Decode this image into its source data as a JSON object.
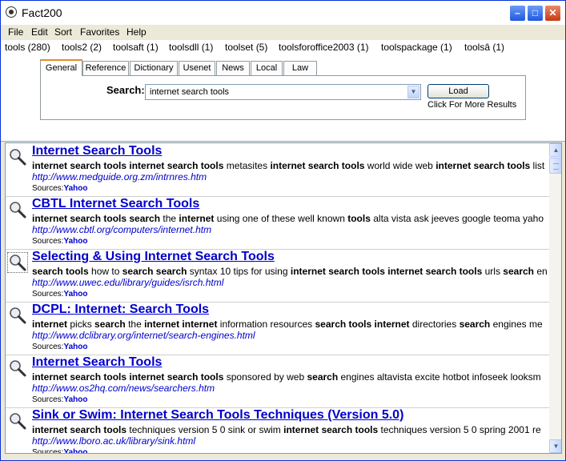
{
  "window": {
    "title": "Fact200"
  },
  "menu": [
    "File",
    "Edit",
    "Sort",
    "Favorites",
    "Help"
  ],
  "query_tabs": [
    "tools (280)",
    "tools2 (2)",
    "toolsaft (1)",
    "toolsdll (1)",
    "toolset (5)",
    "toolsforoffice2003 (1)",
    "toolspackage (1)",
    "toolsâ (1)"
  ],
  "source_tabs": [
    "General",
    "Reference",
    "Dictionary",
    "Usenet",
    "News",
    "Local",
    "Law"
  ],
  "search": {
    "label": "Search:",
    "value": "internet search tools"
  },
  "load": {
    "label": "Load",
    "hint": "Click For More Results"
  },
  "sources_label": "Sources:",
  "results": [
    {
      "title": "Internet Search Tools",
      "snippet": [
        {
          "t": "internet search tools internet search tools",
          "b": true
        },
        {
          "t": " metasites ",
          "b": false
        },
        {
          "t": "internet search tools",
          "b": true
        },
        {
          "t": " world wide web ",
          "b": false
        },
        {
          "t": "internet search tools",
          "b": true
        },
        {
          "t": " list",
          "b": false
        }
      ],
      "url": "http://www.medguide.org.zm/intrnres.htm",
      "source": "Yahoo"
    },
    {
      "title": "CBTL Internet Search Tools",
      "snippet": [
        {
          "t": "internet search tools search",
          "b": true
        },
        {
          "t": " the ",
          "b": false
        },
        {
          "t": "internet",
          "b": true
        },
        {
          "t": " using one of these well known ",
          "b": false
        },
        {
          "t": "tools",
          "b": true
        },
        {
          "t": " alta vista ask jeeves google teoma yaho",
          "b": false
        }
      ],
      "url": "http://www.cbtl.org/computers/internet.htm",
      "source": "Yahoo"
    },
    {
      "title": "Selecting & Using Internet Search Tools",
      "snippet": [
        {
          "t": "search tools",
          "b": true
        },
        {
          "t": " how to ",
          "b": false
        },
        {
          "t": "search search",
          "b": true
        },
        {
          "t": " syntax 10 tips for using ",
          "b": false
        },
        {
          "t": "internet search tools internet search tools",
          "b": true
        },
        {
          "t": " urls ",
          "b": false
        },
        {
          "t": "search",
          "b": true
        },
        {
          "t": " en",
          "b": false
        }
      ],
      "url": "http://www.uwec.edu/library/guides/isrch.html",
      "source": "Yahoo"
    },
    {
      "title": "DCPL: Internet: Search Tools",
      "snippet": [
        {
          "t": "internet",
          "b": true
        },
        {
          "t": " picks ",
          "b": false
        },
        {
          "t": "search",
          "b": true
        },
        {
          "t": " the ",
          "b": false
        },
        {
          "t": "internet internet",
          "b": true
        },
        {
          "t": " information resources ",
          "b": false
        },
        {
          "t": "search tools internet",
          "b": true
        },
        {
          "t": " directories ",
          "b": false
        },
        {
          "t": "search",
          "b": true
        },
        {
          "t": " engines me",
          "b": false
        }
      ],
      "url": "http://www.dclibrary.org/internet/search-engines.html",
      "source": "Yahoo"
    },
    {
      "title": "Internet Search Tools",
      "snippet": [
        {
          "t": "internet search tools internet search tools",
          "b": true
        },
        {
          "t": " sponsored by web ",
          "b": false
        },
        {
          "t": "search",
          "b": true
        },
        {
          "t": " engines altavista excite hotbot infoseek looksm",
          "b": false
        }
      ],
      "url": "http://www.os2hq.com/news/searchers.htm",
      "source": "Yahoo"
    },
    {
      "title": "Sink or Swim: Internet Search Tools  Techniques (Version 5.0)",
      "snippet": [
        {
          "t": "internet search tools",
          "b": true
        },
        {
          "t": " techniques version 5 0 sink or swim ",
          "b": false
        },
        {
          "t": "internet search tools",
          "b": true
        },
        {
          "t": " techniques version 5 0 spring 2001 re",
          "b": false
        }
      ],
      "url": "http://www.lboro.ac.uk/library/sink.html",
      "source": "Yahoo"
    }
  ]
}
